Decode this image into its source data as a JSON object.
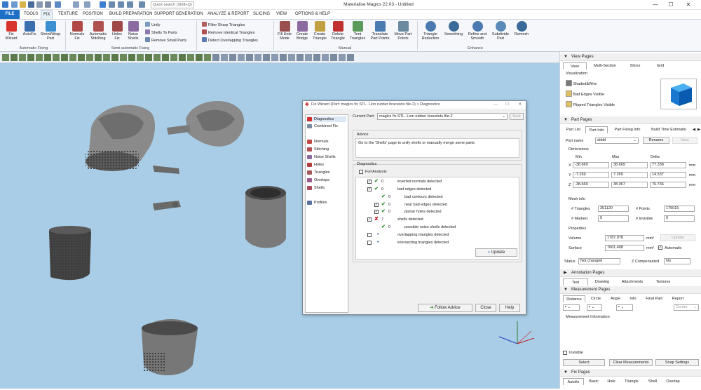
{
  "title_bar": {
    "app_title": "Materialise Magics 22.03 - Untitled",
    "search_placeholder": "Quick search (Shift+Q)",
    "minimize": "—",
    "maximize": "☐",
    "close": "✕"
  },
  "ribbon_tabs": [
    "FILE",
    "TOOLS",
    "FIX",
    "TEXTURE",
    "POSITION",
    "BUILD PREPARATION",
    "SUPPORT GENERATION",
    "ANALYZE & REPORT",
    "SLICING",
    "VIEW",
    "OPTIONS & HELP"
  ],
  "ribbon": {
    "auto": {
      "buttons": [
        {
          "label": "Fix\nWizard",
          "color": "#d9342b"
        },
        {
          "label": "AutoFix",
          "color": "#3a6fb0"
        },
        {
          "label": "ShrinkWrap\nPart",
          "color": "#3a8fd0"
        }
      ],
      "group": "Automatic Fixing"
    },
    "semi": {
      "buttons": [
        {
          "label": "Normals\nFix"
        },
        {
          "label": "Automatic\nStitching"
        },
        {
          "label": "Holes\nFix"
        },
        {
          "label": "Noise\nShells"
        }
      ],
      "small": [
        "Unify",
        "Shells To Parts",
        "Remove Small Parts"
      ],
      "group": "Semi-automatic Fixing"
    },
    "triangles_small": [
      "Filter Sharp Triangles",
      "Remove Identical Triangles",
      "Detect Overlapping Triangles"
    ],
    "manual": {
      "buttons": [
        {
          "label": "Fill Hole\nMode"
        },
        {
          "label": "Create\nBridge"
        },
        {
          "label": "Create\nTriangle"
        },
        {
          "label": "Delete\nTriangle"
        },
        {
          "label": "Tent\nTriangles"
        },
        {
          "label": "Translate\nPart Points"
        },
        {
          "label": "Move Part\nPoints"
        }
      ],
      "group": "Manual"
    },
    "enhance": {
      "buttons": [
        {
          "label": "Triangle\nReduction"
        },
        {
          "label": "Smoothing"
        },
        {
          "label": "Refine and\nSmooth"
        },
        {
          "label": "Subdivide\nPart"
        },
        {
          "label": "Remesh"
        }
      ],
      "group": "Enhance"
    }
  },
  "dialog": {
    "title": "Fix Wizard (Part: magics fix STL-  Lion rubber bracelets file-2) > Diagnostics",
    "nav": [
      {
        "label": "Diagnostics",
        "icon": "diagnostics-icon",
        "color": "#d03030"
      },
      {
        "label": "Combined Fix",
        "icon": "combined-fix-icon",
        "color": "#7a8aa0"
      },
      {
        "label": "Normals",
        "icon": "normals-icon",
        "color": "#c04848"
      },
      {
        "label": "Stitching",
        "icon": "stitching-icon",
        "color": "#b05050"
      },
      {
        "label": "Noise Shells",
        "icon": "noise-shells-icon",
        "color": "#8a6aa0"
      },
      {
        "label": "Holes",
        "icon": "holes-icon",
        "color": "#b04040"
      },
      {
        "label": "Triangles",
        "icon": "triangles-icon",
        "color": "#a05858"
      },
      {
        "label": "Overlaps",
        "icon": "overlaps-icon",
        "color": "#9a5a8a"
      },
      {
        "label": "Shells",
        "icon": "shells-icon",
        "color": "#aa4a5a"
      },
      {
        "label": "Profiles",
        "icon": "profiles-icon",
        "color": "#5a70a0"
      }
    ],
    "current_part_label": "Current Part:",
    "current_part_value": "magics fix STL-  Lion rubber bracelets file-2",
    "next_label": "Next",
    "advice_header": "Advice",
    "advice_text": "Go to the 'Shells' page to unify shells or manually merge some parts.",
    "diagnostics_header": "Diagnostics",
    "full_analysis": "Full Analysis",
    "rows": [
      {
        "checked": true,
        "mark": "✔",
        "count": "0",
        "text": "inverted normals detected",
        "indent": 0
      },
      {
        "checked": true,
        "mark": "✔",
        "count": "0",
        "text": "bad edges detected",
        "indent": 0
      },
      {
        "checked": false,
        "mark": "✔",
        "count": "0",
        "text": "bad contours detected",
        "indent": 1
      },
      {
        "checked": true,
        "mark": "✔",
        "count": "0",
        "text": "near bad edges detected",
        "indent": 1
      },
      {
        "checked": true,
        "mark": "✔",
        "count": "0",
        "text": "planar holes detected",
        "indent": 1
      },
      {
        "checked": true,
        "mark": "✘",
        "count": "7",
        "text": "shells detected",
        "indent": 0
      },
      {
        "checked": false,
        "mark": "✔",
        "count": "0",
        "text": "possible noise shells detected",
        "indent": 1
      },
      {
        "checked": false,
        "mark": "•",
        "count": "",
        "text": "overlapping triangles detected",
        "indent": 0
      },
      {
        "checked": false,
        "mark": "•",
        "count": "",
        "text": "intersecting triangles detected",
        "indent": 0
      }
    ],
    "update": "Update",
    "follow_advice": "Follow Advice",
    "close": "Close",
    "help": "Help"
  },
  "right_panel": {
    "view_pages": "View Pages",
    "view_tabs": [
      "View",
      "Multi-Section",
      "Slices",
      "Grid"
    ],
    "visualization": "Visualization",
    "vis_items": [
      "Shaded&Wire",
      "Bad Edges Visible",
      "Flipped Triangles Visible"
    ],
    "part_pages": "Part Pages",
    "part_tabs": [
      "Part List",
      "Part Info",
      "Part Fixing Info",
      "Build Time Estimatio"
    ],
    "part_name_label": "Part name",
    "part_name_value": "dddd",
    "rename": "Rename",
    "next": "Next",
    "dimensions": "Dimensions",
    "dim_cols": [
      "Min",
      "Max",
      "Delta"
    ],
    "dim_rows": [
      {
        "axis": "X",
        "min": "-38.669",
        "max": "38.669",
        "delta": "77.338",
        "unit": "mm"
      },
      {
        "axis": "Y",
        "min": "-7.269",
        "max": "7.269",
        "delta": "14.537",
        "unit": "mm"
      },
      {
        "axis": "Z",
        "min": "-38.669",
        "max": "38.067",
        "delta": "76.736",
        "unit": "mm"
      }
    ],
    "mesh_info": "Mesh info",
    "triangles_label": "# Triangles",
    "triangles": "351120",
    "points_label": "# Points",
    "points": "175015",
    "marked_label": "# Marked",
    "marked": "0",
    "invisible_label": "# Invisible",
    "invisible": "0",
    "properties": "Properties",
    "volume_label": "Volume",
    "volume": "1787.978",
    "volume_unit": "mm³",
    "volume_update": "Update",
    "surface_label": "Surface",
    "surface": "7661.408",
    "surface_unit": "mm²",
    "automatic": "Automatic",
    "status_label": "Status",
    "status": "Not changed",
    "zcomp_label": "Z Compensated",
    "zcomp": "No",
    "annotation_pages": "Annotation Pages",
    "annotation_tabs": [
      "Text",
      "Drawing",
      "Attachments",
      "Textures"
    ],
    "measurement_pages": "Measurement Pages",
    "measurement_tabs": [
      "Distance",
      "Circle",
      "Angle",
      "Info",
      "Final Part",
      "Report"
    ],
    "center": "Center",
    "measurement_info": "Measurement Information",
    "invisible_cb": "Invisible",
    "select": "Select",
    "clear": "Clear Measurements",
    "snap": "Snap Settings",
    "fix_pages": "Fix Pages",
    "fix_tabs": [
      "Autofix",
      "Basic",
      "Hole",
      "Triangle",
      "Shell",
      "Overlap"
    ]
  },
  "colors": {
    "viewport_bg": "#a9cde6",
    "accent_blue": "#1e6fc6",
    "ok_green": "#2e8b2e",
    "error_red": "#c82020"
  }
}
